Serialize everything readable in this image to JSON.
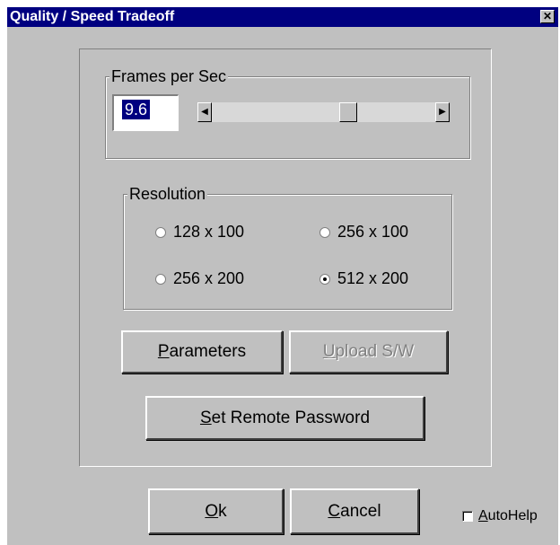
{
  "window": {
    "title": "Quality / Speed Tradeoff",
    "close_glyph": "✕"
  },
  "fps_group": {
    "legend": "Frames per Sec",
    "value": "9.6",
    "slider_level": 0.62,
    "left_arrow": "◀",
    "right_arrow": "▶"
  },
  "resolution_group": {
    "legend": "Resolution",
    "options": [
      {
        "label": "128 x 100",
        "checked": false
      },
      {
        "label": "256 x 100",
        "checked": false
      },
      {
        "label": "256 x 200",
        "checked": false
      },
      {
        "label": "512 x 200",
        "checked": true
      }
    ]
  },
  "buttons": {
    "parameters": {
      "accel": "P",
      "rest": "arameters"
    },
    "upload": {
      "accel": "U",
      "rest": "pload S/W",
      "disabled": true
    },
    "set_password": {
      "accel": "S",
      "rest": "et Remote Password"
    },
    "ok": {
      "accel": "O",
      "rest": "k"
    },
    "cancel": {
      "accel": "C",
      "rest": "ancel"
    }
  },
  "autohelp": {
    "accel": "A",
    "rest": "utoHelp",
    "checked": false
  },
  "colors": {
    "title_bar": "#000080",
    "dialog_face": "#c0c0c0",
    "highlight": "#000080"
  }
}
